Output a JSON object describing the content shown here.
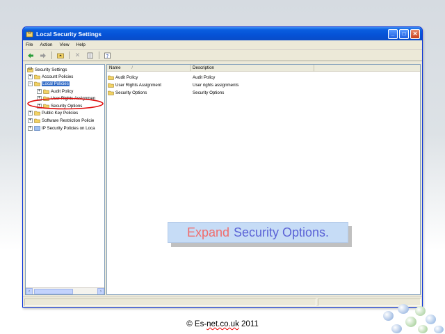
{
  "window": {
    "title": "Local Security Settings",
    "menu": [
      "File",
      "Action",
      "View",
      "Help"
    ],
    "controls": {
      "minimize": "_",
      "maximize": "□",
      "close": "✕"
    }
  },
  "toolbar": {
    "icons": [
      "back-icon",
      "forward-icon",
      "up-folder-icon",
      "delete-icon",
      "export-list-icon",
      "help-icon"
    ]
  },
  "tree": {
    "root": "Security Settings",
    "items": [
      {
        "label": "Account Policies",
        "level": 1,
        "expander": "+"
      },
      {
        "label": "Local Policies",
        "level": 1,
        "expander": "−",
        "selected": true
      },
      {
        "label": "Audit Policy",
        "level": 2,
        "expander": "+"
      },
      {
        "label": "User Rights Assignmen",
        "level": 2,
        "expander": "+"
      },
      {
        "label": "Security Options",
        "level": 2,
        "expander": "+",
        "circled": true
      },
      {
        "label": "Public Key Policies",
        "level": 1,
        "expander": "+"
      },
      {
        "label": "Software Restriction Policie",
        "level": 1,
        "expander": "+"
      },
      {
        "label": "IP Security Policies on Loca",
        "level": 1,
        "expander": "+"
      }
    ]
  },
  "list": {
    "columns": [
      "Name",
      "Description"
    ],
    "sort_indicator": "/",
    "rows": [
      {
        "name": "Audit Policy",
        "description": "Audit Policy"
      },
      {
        "name": "User Rights Assignment",
        "description": "User rights assignments"
      },
      {
        "name": "Security Options",
        "description": "Security Options"
      }
    ]
  },
  "callout": {
    "part1": "Expand",
    "part2": "Security Options."
  },
  "footer": {
    "prefix": "© Es-",
    "underlined": "net.co.uk",
    "suffix": " 2011"
  },
  "colors": {
    "title_bar": "#0552d6",
    "selection": "#316ac5",
    "circle_annotation": "#e01010",
    "callout_bg": "#c6dcf6",
    "callout_word1": "#f06c6c",
    "callout_word2": "#5b63d6"
  }
}
